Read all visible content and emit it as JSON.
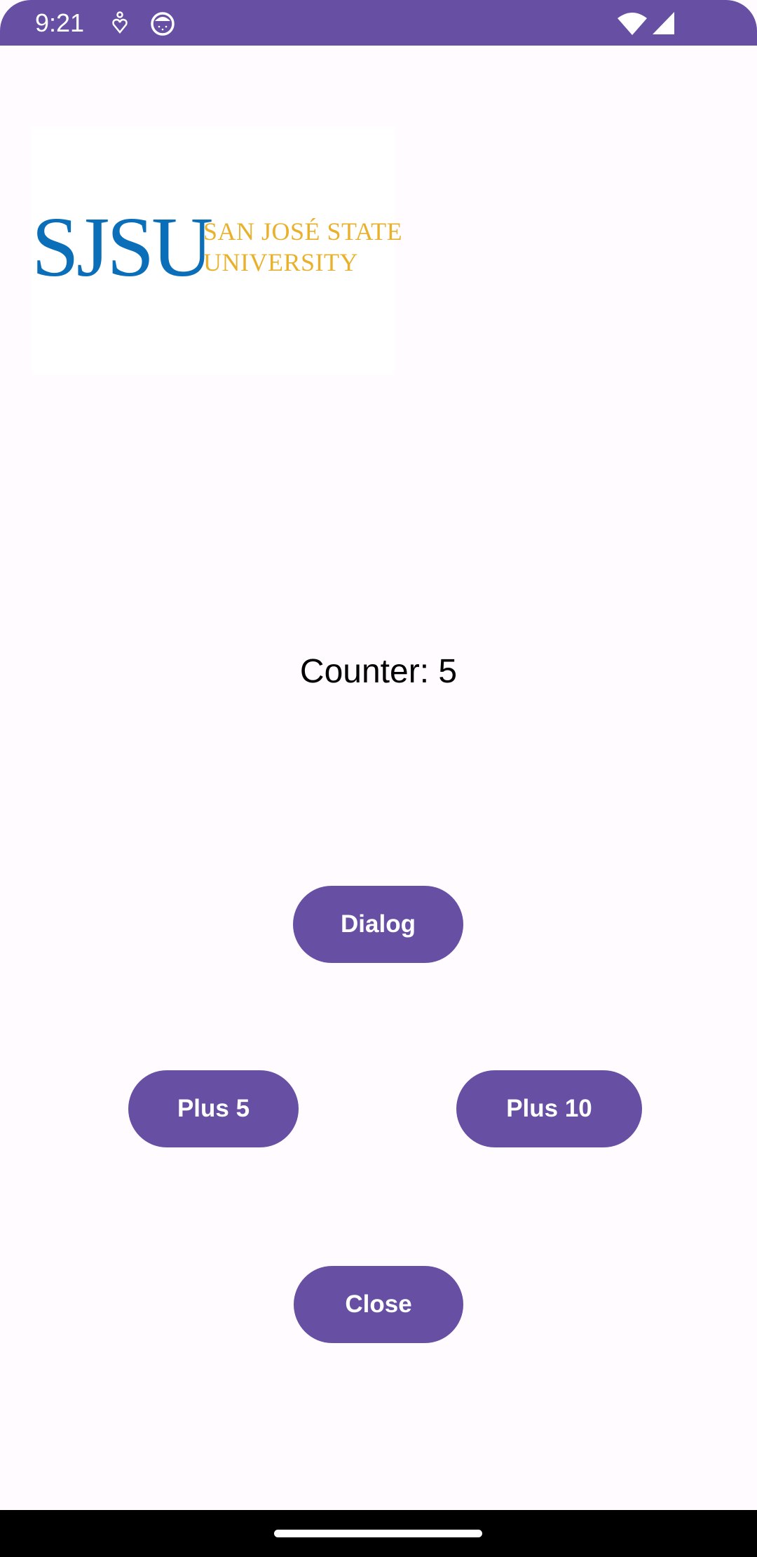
{
  "status_bar": {
    "time": "9:21",
    "icons": [
      "accessibility-icon",
      "android-debug-icon",
      "wifi-icon",
      "cell-signal-icon"
    ],
    "color": "#6750a4"
  },
  "logo": {
    "mark": "SJSU",
    "name_line1": "SAN JOSÉ STATE",
    "name_line2": "UNIVERSITY"
  },
  "counter": {
    "text": "Counter: 5"
  },
  "buttons": {
    "dialog": "Dialog",
    "plus5": "Plus 5",
    "plus10": "Plus 10",
    "close": "Close"
  },
  "theme": {
    "primary": "#6750a4",
    "background": "#fffbfe"
  }
}
